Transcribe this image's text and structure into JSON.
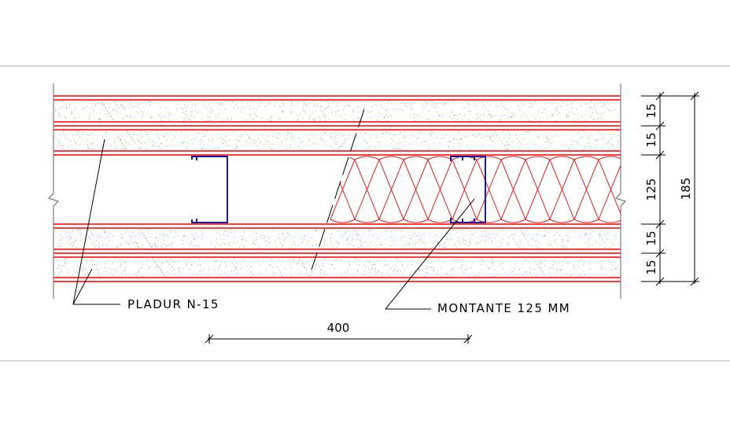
{
  "colors": {
    "board_line": "#ff3b3b",
    "insulation": "#e02020",
    "stud": "#1a1aa0",
    "ink": "#000000",
    "frame": "#b4b4b4",
    "speckle": "#9a9a9a"
  },
  "labels": {
    "board": "PLADUR N-15",
    "stud": "MONTANTE 125 MM"
  },
  "dimensions": {
    "stud_spacing": "400",
    "layers": [
      "15",
      "15",
      "125",
      "15",
      "15"
    ],
    "total": "185"
  }
}
